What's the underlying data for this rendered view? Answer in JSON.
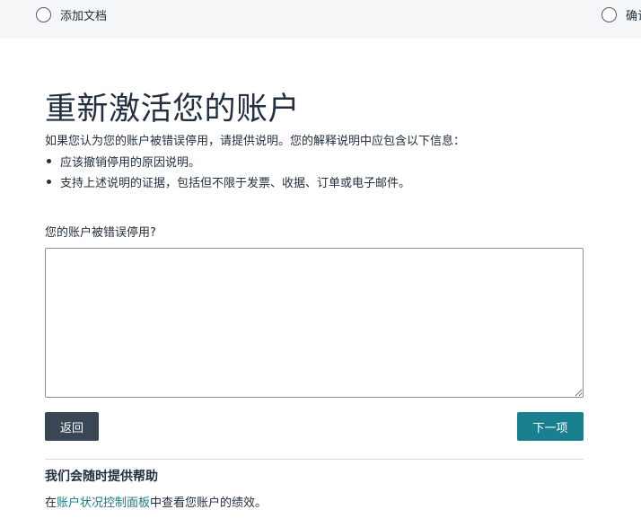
{
  "stepper": {
    "steps": [
      {
        "label": "添加文档"
      },
      {
        "label": "确认"
      }
    ]
  },
  "page": {
    "title": "重新激活您的账户",
    "intro": "如果您认为您的账户被错误停用，请提供说明。您的解释说明中应包含以下信息：",
    "bullets": [
      "应该撤销停用的原因说明。",
      "支持上述说明的证据，包括但不限于发票、收据、订单或电子邮件。"
    ]
  },
  "form": {
    "question_label": "您的账户被错误停用?",
    "explanation_value": ""
  },
  "buttons": {
    "back_label": "返回",
    "next_label": "下一项"
  },
  "help": {
    "title": "我们会随时提供帮助",
    "prefix": "在",
    "link_text": "账户状况控制面板",
    "suffix": "中查看您账户的绩效。"
  },
  "colors": {
    "accent_button": "#18808f",
    "back_button": "#3b4654",
    "link": "#1b7a85"
  }
}
